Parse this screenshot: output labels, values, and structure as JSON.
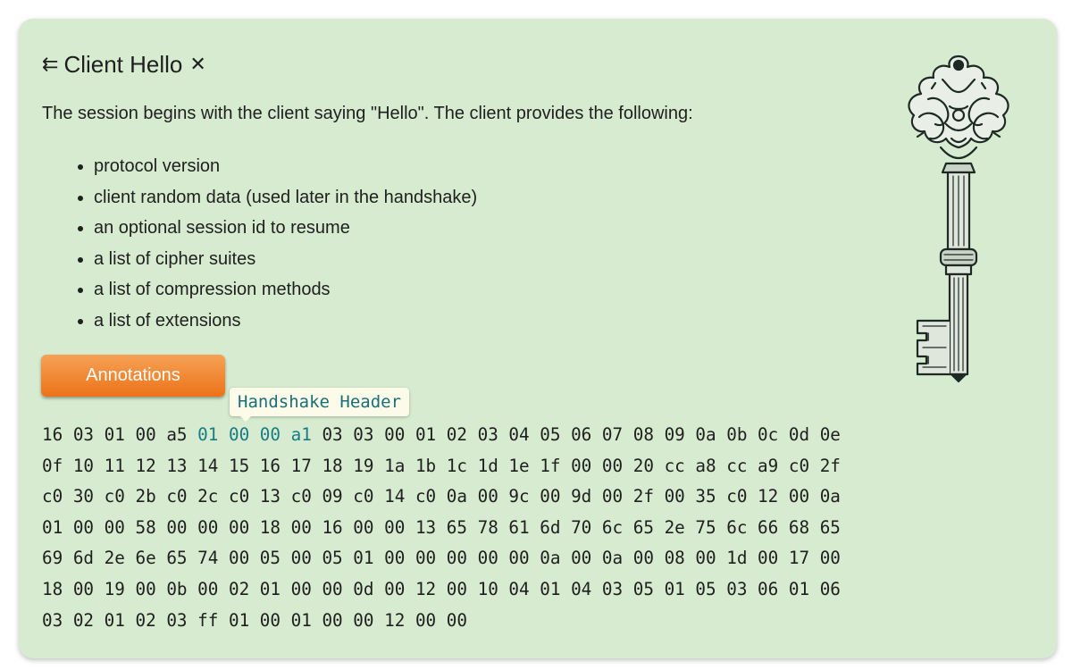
{
  "header": {
    "back_icon": "leftwards-arrows-icon",
    "title": "Client Hello",
    "close_icon": "close-icon"
  },
  "intro": "The session begins with the client saying \"Hello\". The client provides the following:",
  "bullets": [
    "protocol version",
    "client random data (used later in the handshake)",
    "an optional session id to resume",
    "a list of cipher suites",
    "a list of compression methods",
    "a list of extensions"
  ],
  "illustration": {
    "name": "vintage-key-illustration"
  },
  "annotations_button": {
    "label": "Annotations"
  },
  "tooltip": {
    "label": "Handshake Header"
  },
  "hex": {
    "highlight_range": [
      5,
      8
    ],
    "lines": [
      [
        "16",
        "03",
        "01",
        "00",
        "a5",
        "01",
        "00",
        "00",
        "a1",
        "03",
        "03",
        "00",
        "01",
        "02",
        "03",
        "04",
        "05",
        "06",
        "07",
        "08",
        "09",
        "0a",
        "0b",
        "0c",
        "0d",
        "0e"
      ],
      [
        "0f",
        "10",
        "11",
        "12",
        "13",
        "14",
        "15",
        "16",
        "17",
        "18",
        "19",
        "1a",
        "1b",
        "1c",
        "1d",
        "1e",
        "1f",
        "00",
        "00",
        "20",
        "cc",
        "a8",
        "cc",
        "a9",
        "c0",
        "2f"
      ],
      [
        "c0",
        "30",
        "c0",
        "2b",
        "c0",
        "2c",
        "c0",
        "13",
        "c0",
        "09",
        "c0",
        "14",
        "c0",
        "0a",
        "00",
        "9c",
        "00",
        "9d",
        "00",
        "2f",
        "00",
        "35",
        "c0",
        "12",
        "00",
        "0a"
      ],
      [
        "01",
        "00",
        "00",
        "58",
        "00",
        "00",
        "00",
        "18",
        "00",
        "16",
        "00",
        "00",
        "13",
        "65",
        "78",
        "61",
        "6d",
        "70",
        "6c",
        "65",
        "2e",
        "75",
        "6c",
        "66",
        "68",
        "65"
      ],
      [
        "69",
        "6d",
        "2e",
        "6e",
        "65",
        "74",
        "00",
        "05",
        "00",
        "05",
        "01",
        "00",
        "00",
        "00",
        "00",
        "00",
        "0a",
        "00",
        "0a",
        "00",
        "08",
        "00",
        "1d",
        "00",
        "17",
        "00"
      ],
      [
        "18",
        "00",
        "19",
        "00",
        "0b",
        "00",
        "02",
        "01",
        "00",
        "00",
        "0d",
        "00",
        "12",
        "00",
        "10",
        "04",
        "01",
        "04",
        "03",
        "05",
        "01",
        "05",
        "03",
        "06",
        "01",
        "06"
      ],
      [
        "03",
        "02",
        "01",
        "02",
        "03",
        "ff",
        "01",
        "00",
        "01",
        "00",
        "00",
        "12",
        "00",
        "00"
      ]
    ]
  },
  "colors": {
    "card_bg": "#d6ebcf",
    "button_orange": "#ec7318",
    "highlight_teal": "#187c84",
    "tooltip_bg": "#fcfbe9"
  }
}
